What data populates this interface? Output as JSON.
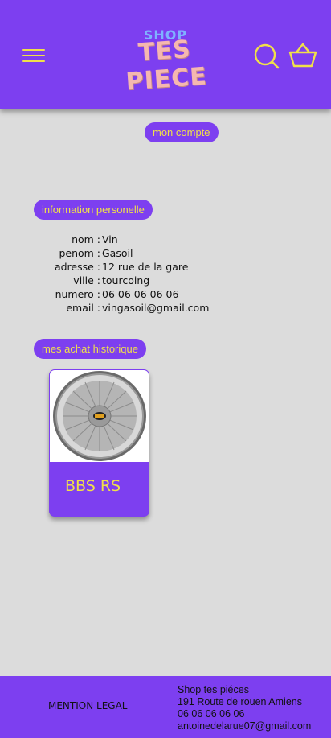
{
  "header": {
    "logo_top": "SHOP",
    "logo_main": "TES PIECE",
    "menu_icon": "hamburger-menu-icon",
    "search_icon": "search-icon",
    "cart_icon": "basket-icon",
    "accent_color": "#f0e04a",
    "brand_color": "#7d3ff0"
  },
  "account": {
    "button_label": "mon compte"
  },
  "personal_info": {
    "section_label": "information personelle",
    "rows": [
      {
        "label": "nom :",
        "value": "Vin"
      },
      {
        "label": "penom :",
        "value": "Gasoil"
      },
      {
        "label": "adresse :",
        "value": "12 rue de la gare"
      },
      {
        "label": "ville :",
        "value": "tourcoing"
      },
      {
        "label": "numero :",
        "value": "06 06 06 06 06"
      },
      {
        "label": "email :",
        "value": "vingasoil@gmail.com"
      }
    ]
  },
  "history": {
    "section_label": "mes achat historique",
    "items": [
      {
        "name": "BBS RS",
        "image": "alloy-wheel-image"
      }
    ]
  },
  "footer": {
    "mention_label": "MENTION LEGAL",
    "contact": {
      "shop_name": "Shop tes piéces",
      "address": "191 Route de rouen Amiens",
      "phone": "06 06 06 06 06",
      "email": "antoinedelarue07@gmail.com"
    }
  }
}
